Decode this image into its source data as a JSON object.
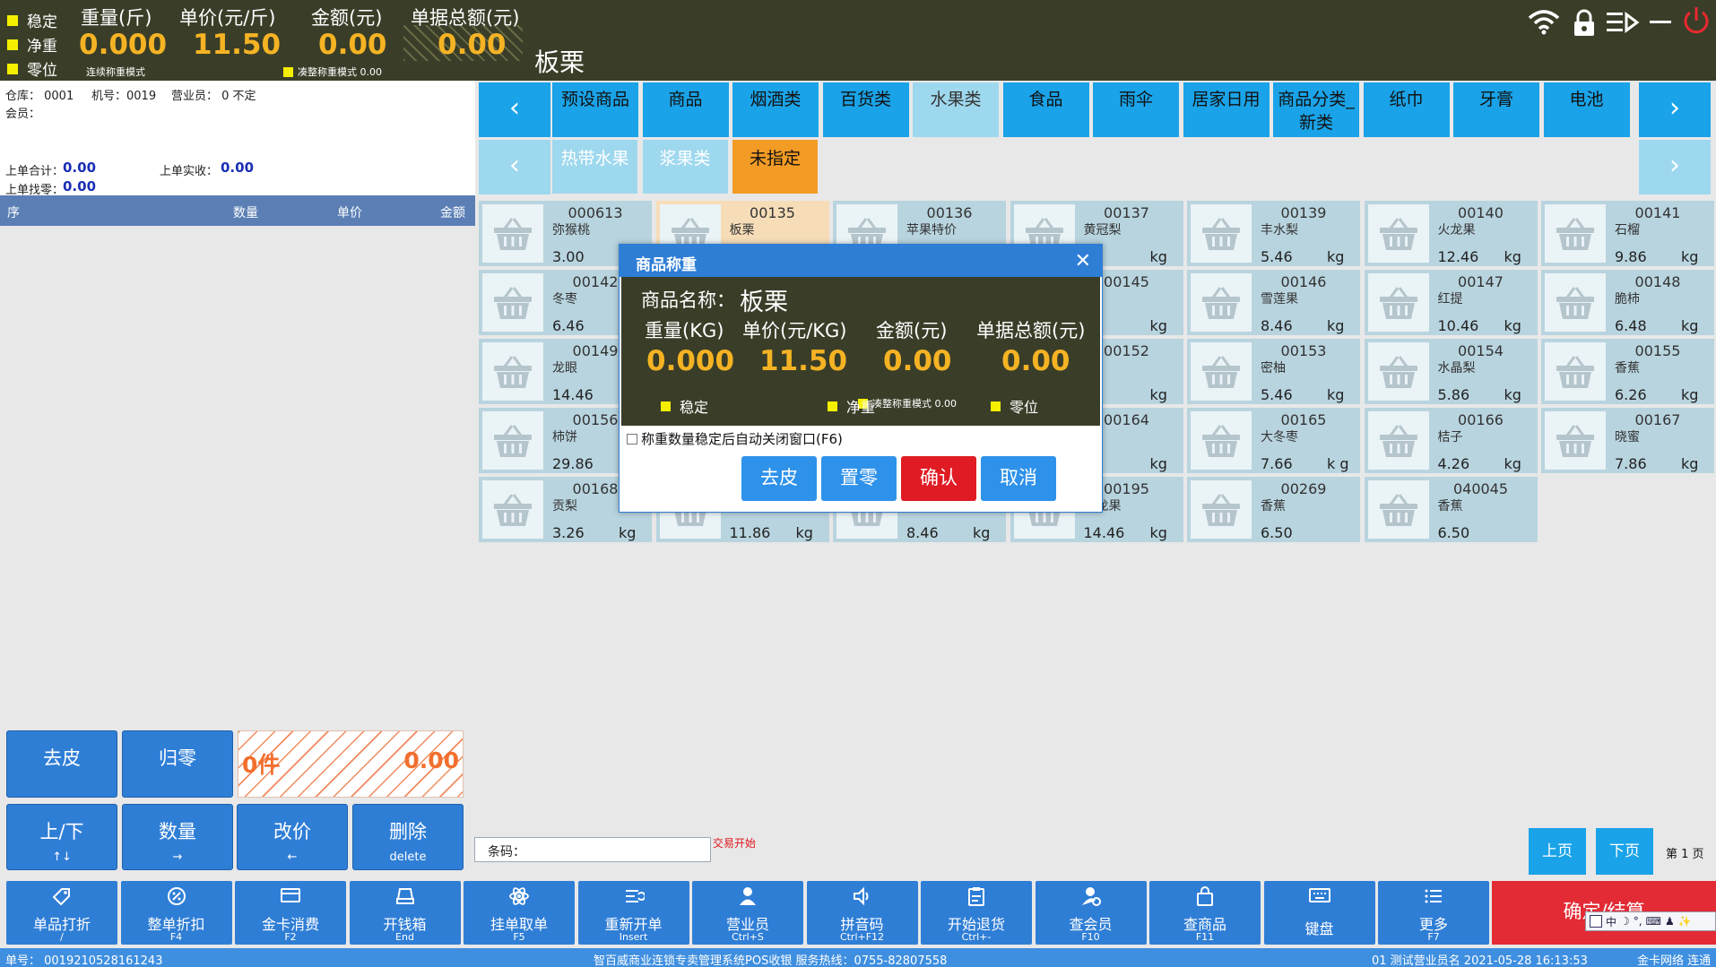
{
  "top": {
    "indicators": [
      "稳定",
      "净重",
      "零位"
    ],
    "weight_label": "重量(斤)",
    "weight_value": "0.000",
    "weight_note": "连续称重模式",
    "price_label": "单价(元/斤)",
    "price_value": "11.50",
    "amount_label": "金额(元)",
    "amount_value": "0.00",
    "amount_note": "凑整称重模式 0.00",
    "total_label": "单据总额(元)",
    "total_value": "0.00",
    "product_name": "板栗"
  },
  "left": {
    "warehouse": "仓库： 0001",
    "machine": "机号：0019",
    "clerk": "营业员： 0 不定",
    "member": "会员：",
    "last_total_label": "上单合计：",
    "last_total_value": "0.00",
    "last_paid_label": "上单实收：",
    "last_paid_value": "0.00",
    "last_change_label": "上单找零：",
    "last_change_value": "0.00",
    "columns": [
      "序",
      "数量",
      "单价",
      "金额"
    ],
    "count_display": "0件",
    "amount_display": "0.00",
    "buttons": [
      {
        "label": "去皮",
        "key": ""
      },
      {
        "label": "归零",
        "key": ""
      },
      {
        "label": "上/下",
        "key": "↑↓"
      },
      {
        "label": "数量",
        "key": "→"
      },
      {
        "label": "改价",
        "key": "←"
      },
      {
        "label": "删除",
        "key": "delete"
      }
    ]
  },
  "categories": {
    "tabs": [
      {
        "label": "预设商品"
      },
      {
        "label": "商品"
      },
      {
        "label": "烟酒类"
      },
      {
        "label": "百货类"
      },
      {
        "label": "水果类",
        "selected": true
      },
      {
        "label": "食品"
      },
      {
        "label": "雨伞"
      },
      {
        "label": "居家日用"
      },
      {
        "label": "商品分类_\n新类"
      },
      {
        "label": "纸巾"
      },
      {
        "label": "牙膏"
      },
      {
        "label": "电池"
      }
    ],
    "subtabs": [
      {
        "label": "热带水果"
      },
      {
        "label": "浆果类"
      },
      {
        "label": "未指定",
        "active": true
      }
    ]
  },
  "products": [
    {
      "code": "000613",
      "name": "弥猴桃",
      "price": "3.00",
      "unit": ""
    },
    {
      "code": "00135",
      "name": "板栗",
      "price": "",
      "unit": "",
      "selected": true
    },
    {
      "code": "00136",
      "name": "苹果特价",
      "price": "",
      "unit": ""
    },
    {
      "code": "00137",
      "name": "黄冠梨",
      "price": "",
      "unit": "kg"
    },
    {
      "code": "00139",
      "name": "丰水梨",
      "price": "5.46",
      "unit": "kg"
    },
    {
      "code": "00140",
      "name": "火龙果",
      "price": "12.46",
      "unit": "kg"
    },
    {
      "code": "00141",
      "name": "石榴",
      "price": "9.86",
      "unit": "kg"
    },
    {
      "code": "00142",
      "name": "冬枣",
      "price": "6.46",
      "unit": ""
    },
    {
      "code": "",
      "name": "",
      "price": "",
      "unit": ""
    },
    {
      "code": "",
      "name": "",
      "price": "",
      "unit": ""
    },
    {
      "code": "00145",
      "name": "",
      "price": "",
      "unit": "kg"
    },
    {
      "code": "00146",
      "name": "雪莲果",
      "price": "8.46",
      "unit": "kg"
    },
    {
      "code": "00147",
      "name": "红提",
      "price": "10.46",
      "unit": "kg"
    },
    {
      "code": "00148",
      "name": "脆柿",
      "price": "6.48",
      "unit": "kg"
    },
    {
      "code": "00149",
      "name": "龙眼",
      "price": "14.46",
      "unit": ""
    },
    {
      "code": "",
      "name": "",
      "price": "",
      "unit": ""
    },
    {
      "code": "",
      "name": "",
      "price": "",
      "unit": ""
    },
    {
      "code": "00152",
      "name": "",
      "price": "",
      "unit": "kg"
    },
    {
      "code": "00153",
      "name": "密柚",
      "price": "5.46",
      "unit": "kg"
    },
    {
      "code": "00154",
      "name": "水晶梨",
      "price": "5.86",
      "unit": "kg"
    },
    {
      "code": "00155",
      "name": "香蕉",
      "price": "6.26",
      "unit": "kg"
    },
    {
      "code": "00156",
      "name": "柿饼",
      "price": "29.86",
      "unit": ""
    },
    {
      "code": "",
      "name": "",
      "price": "",
      "unit": ""
    },
    {
      "code": "",
      "name": "",
      "price": "",
      "unit": ""
    },
    {
      "code": "00164",
      "name": "",
      "price": "",
      "unit": "kg"
    },
    {
      "code": "00165",
      "name": "大冬枣",
      "price": "7.66",
      "unit": "k g"
    },
    {
      "code": "00166",
      "name": "桔子",
      "price": "4.26",
      "unit": "kg"
    },
    {
      "code": "00167",
      "name": "晓蜜",
      "price": "7.86",
      "unit": "kg"
    },
    {
      "code": "00168",
      "name": "贡梨",
      "price": "3.26",
      "unit": "kg"
    },
    {
      "code": "",
      "name": "",
      "price": "11.86",
      "unit": "kg"
    },
    {
      "code": "",
      "name": "",
      "price": "8.46",
      "unit": "kg"
    },
    {
      "code": "00195",
      "name": "火龙果",
      "price": "14.46",
      "unit": "kg"
    },
    {
      "code": "00269",
      "name": "香蕉",
      "price": "6.50",
      "unit": ""
    },
    {
      "code": "040045",
      "name": "香蕉",
      "price": "6.50",
      "unit": ""
    }
  ],
  "barcode": {
    "label": "条码：",
    "tx_status": "交易开始"
  },
  "paging": {
    "prev": "上页",
    "next": "下页",
    "indicator": "第 1 页"
  },
  "toolbar": [
    {
      "label": "单品打折",
      "key": "/",
      "icon": "tag-icon"
    },
    {
      "label": "整单折扣",
      "key": "F4",
      "icon": "percent-icon"
    },
    {
      "label": "金卡消费",
      "key": "F2",
      "icon": "card-icon"
    },
    {
      "label": "开钱箱",
      "key": "End",
      "icon": "cashbox-icon"
    },
    {
      "label": "挂单取单",
      "key": "F5",
      "icon": "atom-icon"
    },
    {
      "label": "重新开单",
      "key": "Insert",
      "icon": "list-icon"
    },
    {
      "label": "营业员",
      "key": "Ctrl+S",
      "icon": "user-icon"
    },
    {
      "label": "拼音码",
      "key": "Ctrl+F12",
      "icon": "speaker-icon"
    },
    {
      "label": "开始退货",
      "key": "Ctrl+-",
      "icon": "clipboard-icon"
    },
    {
      "label": "查会员",
      "key": "F10",
      "icon": "member-icon"
    },
    {
      "label": "查商品",
      "key": "F11",
      "icon": "bag-icon"
    },
    {
      "label": "键盘",
      "key": "",
      "icon": "keyboard-icon"
    },
    {
      "label": "更多",
      "key": "F7",
      "icon": "menu-icon"
    }
  ],
  "checkout_label": "确定/结算",
  "ime_label": "中",
  "status": {
    "order_no": "单号： 0019210528161243",
    "system": "智百威商业连锁专卖管理系统POS收银   服务热线：0755-82807558",
    "clerk_time": "01 测试营业员名 2021-05-28 16:13:53",
    "network": "金卡网络 连通"
  },
  "dialog": {
    "title": "商品称重",
    "name_label": "商品名称：",
    "name_value": "板栗",
    "weight_label": "重量(KG)",
    "weight_value": "0.000",
    "price_label": "单价(元/KG)",
    "price_value": "11.50",
    "amount_label": "金额(元)",
    "amount_value": "0.00",
    "total_label": "单据总额(元)",
    "total_value": "0.00",
    "mode_note": "凑整称重模式 0.00",
    "indicators": [
      "稳定",
      "净重",
      "零位"
    ],
    "auto_close": "称重数量稳定后自动关闭窗口(F6)",
    "buttons": [
      "去皮",
      "置零",
      "确认",
      "取消"
    ]
  },
  "colors": {
    "accent": "#2f7ed6",
    "cyan": "#1aa3e8",
    "orange": "#f29b25",
    "value": "#f5b324",
    "danger": "#e01b23"
  }
}
